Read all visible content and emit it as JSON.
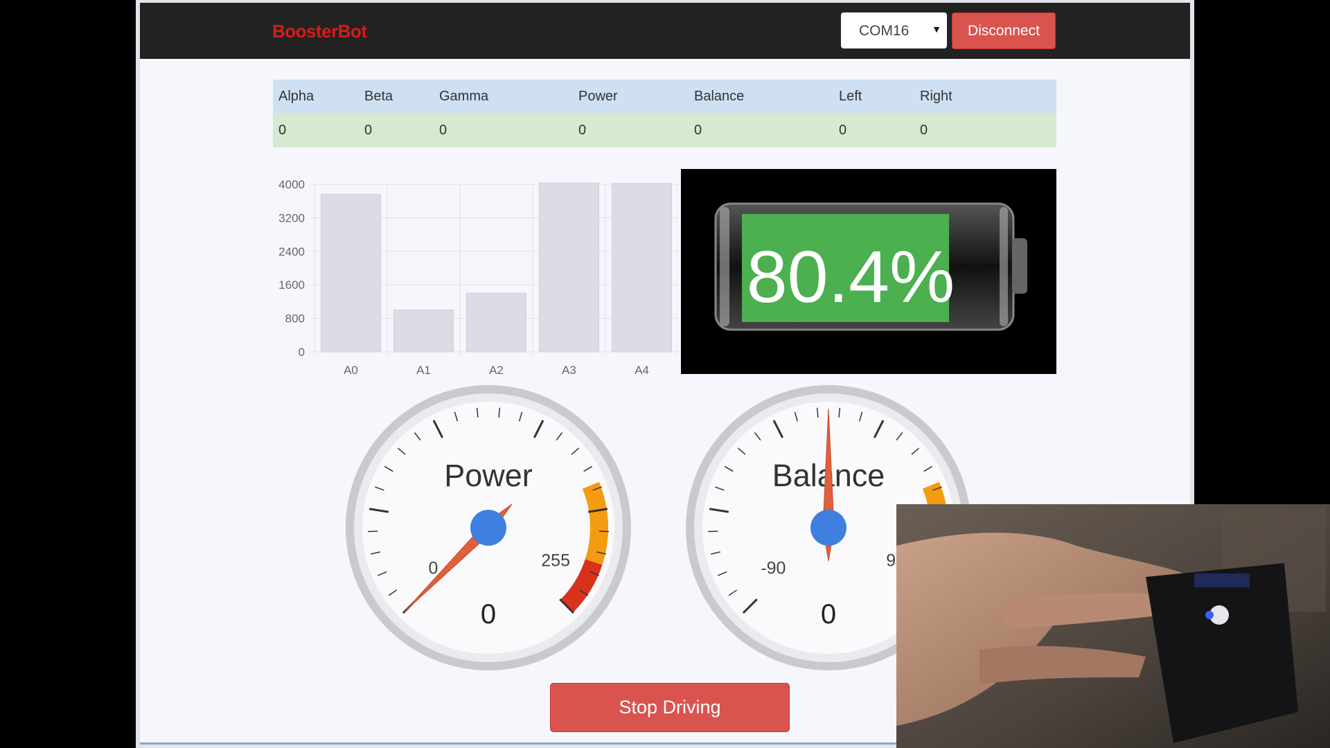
{
  "navbar": {
    "brand": "BoosterBot",
    "port_value": "COM16",
    "disconnect_label": "Disconnect"
  },
  "telemetry": {
    "headers": [
      "Alpha",
      "Beta",
      "Gamma",
      "Power",
      "Balance",
      "Left",
      "Right"
    ],
    "values": [
      "0",
      "0",
      "0",
      "0",
      "0",
      "0",
      "0"
    ]
  },
  "chart_data": {
    "type": "bar",
    "categories": [
      "A0",
      "A1",
      "A2",
      "A3",
      "A4"
    ],
    "values": [
      3760,
      1000,
      1400,
      4050,
      4020
    ],
    "ylim": [
      0,
      4000
    ],
    "yticks": [
      0,
      800,
      1600,
      2400,
      3200,
      4000
    ],
    "grid": true,
    "bar_color": "#dcdce6"
  },
  "battery": {
    "percent_text": "80.4%",
    "level": 0.804,
    "fill_color": "#4caf50"
  },
  "gauges": {
    "power": {
      "title": "Power",
      "value_text": "0",
      "min_label": "0",
      "max_label": "255",
      "value": 0
    },
    "balance": {
      "title": "Balance",
      "value_text": "0",
      "min_label": "-90",
      "max_label": "90",
      "value": 0
    }
  },
  "actions": {
    "stop_label": "Stop Driving"
  },
  "colors": {
    "danger": "#d9534f",
    "brand": "#d41c1c",
    "needle": "#e0603c",
    "hub": "#3f7fe0",
    "warn": "#f39c12",
    "critical": "#d8321c"
  }
}
